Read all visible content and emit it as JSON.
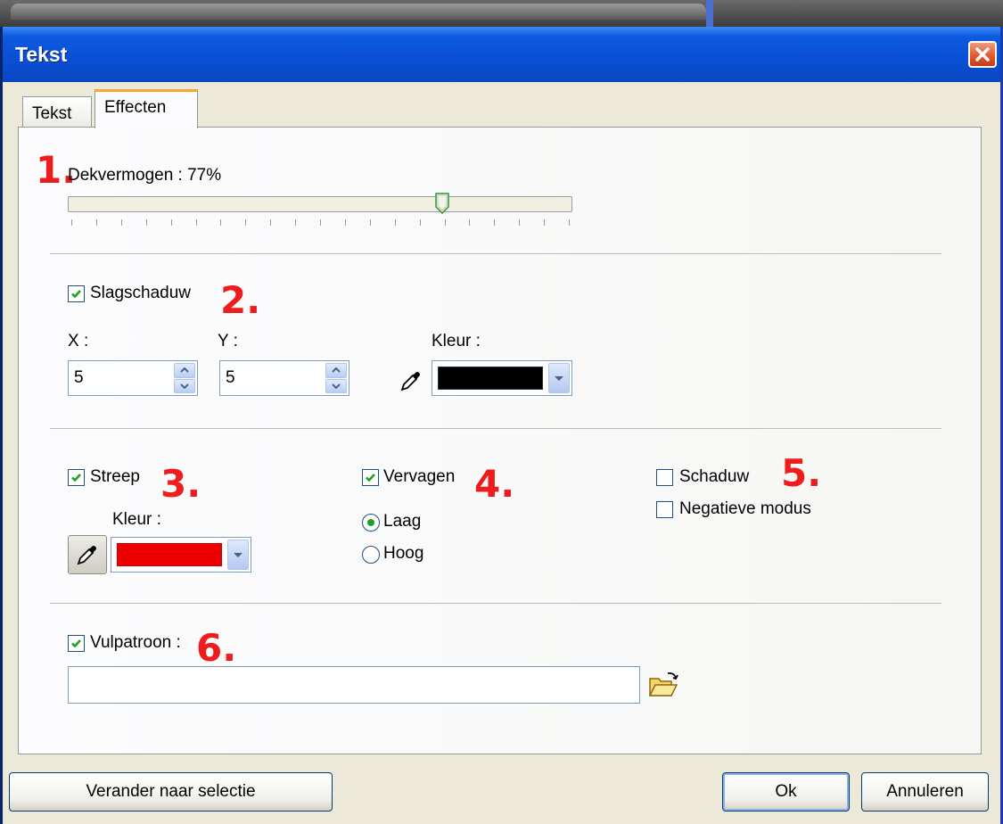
{
  "window": {
    "title": "Tekst"
  },
  "tabs": [
    {
      "label": "Tekst"
    },
    {
      "label": "Effecten"
    }
  ],
  "opacity": {
    "label": "Dekvermogen : 77%",
    "value_percent": 77,
    "marker": "1."
  },
  "drop_shadow": {
    "checked": true,
    "label": "Slagschaduw",
    "marker": "2.",
    "x_label": "X :",
    "x_value": "5",
    "y_label": "Y :",
    "y_value": "5",
    "color_label": "Kleur :",
    "color": "#000000"
  },
  "stroke": {
    "checked": true,
    "label": "Streep",
    "marker": "3.",
    "color_label": "Kleur :",
    "color": "#ee0000"
  },
  "fade": {
    "checked": true,
    "label": "Vervagen",
    "marker": "4.",
    "options": [
      {
        "label": "Laag",
        "selected": true
      },
      {
        "label": "Hoog",
        "selected": false
      }
    ]
  },
  "shadow": {
    "checked": false,
    "label": "Schaduw",
    "marker": "5."
  },
  "negative": {
    "checked": false,
    "label": "Negatieve modus"
  },
  "fill_pattern": {
    "checked": true,
    "label": "Vulpatroon :",
    "marker": "6.",
    "value": ""
  },
  "buttons": {
    "apply_selection": "Verander naar selectie",
    "ok": "Ok",
    "cancel": "Annuleren"
  },
  "icons": [
    "close-icon",
    "eyedropper-icon",
    "chevron-down-icon",
    "spin-up-icon",
    "spin-down-icon",
    "open-folder-icon",
    "checkmark-icon"
  ]
}
